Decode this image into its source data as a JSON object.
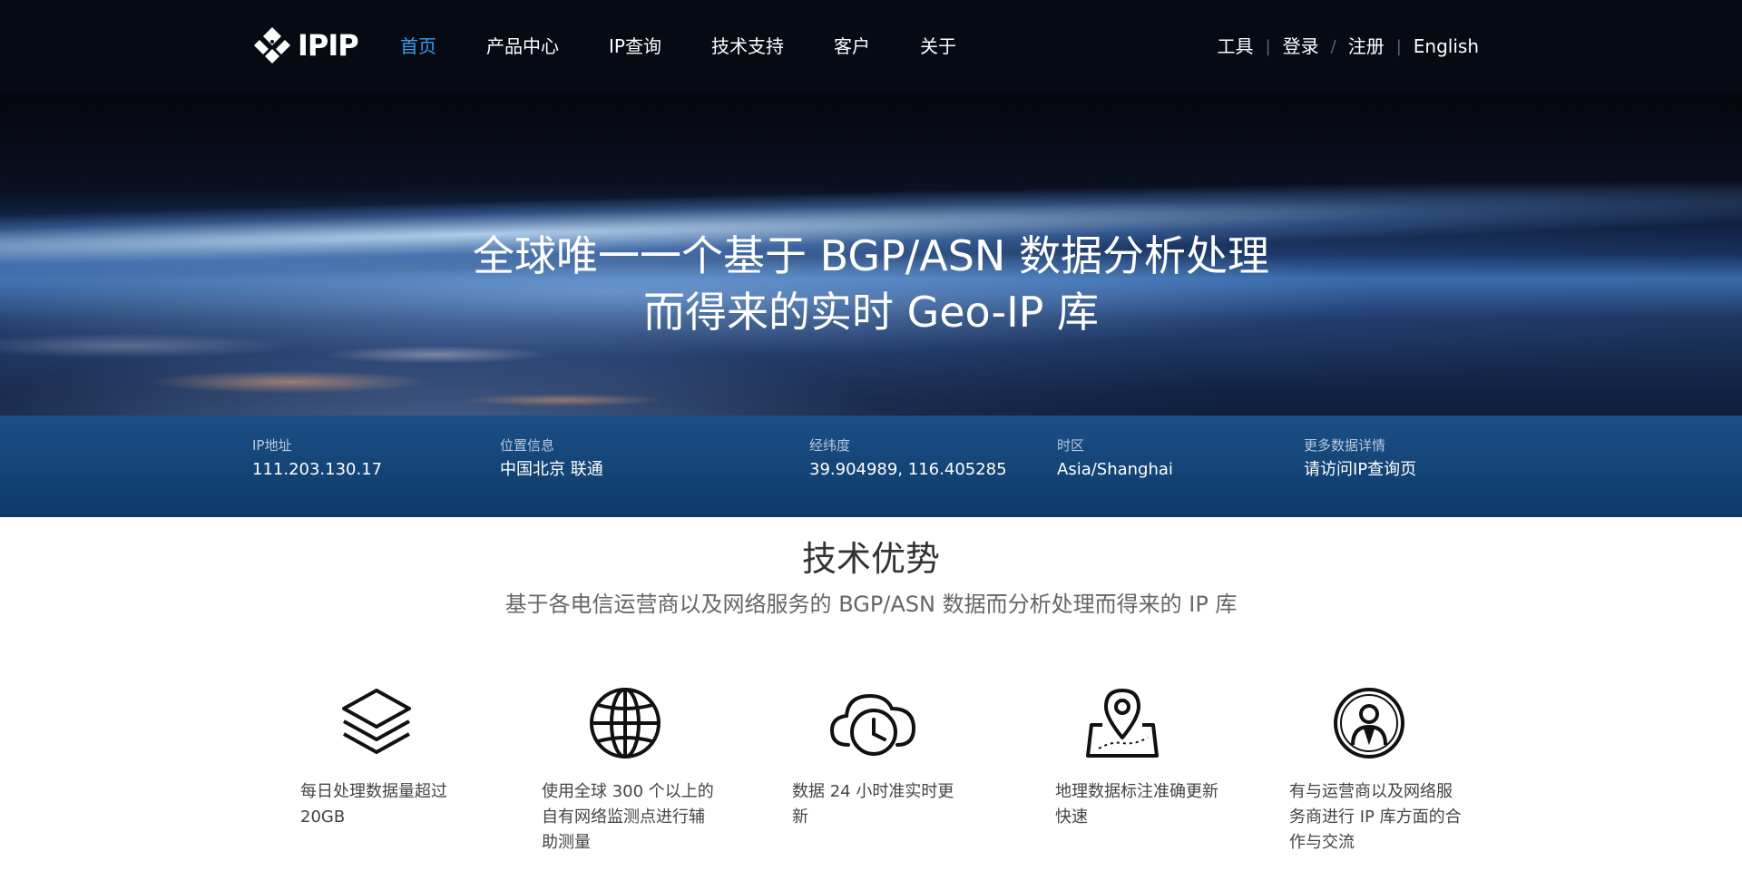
{
  "header": {
    "logo_text": "IPIP",
    "nav": [
      {
        "label": "首页",
        "active": true
      },
      {
        "label": "产品中心",
        "active": false
      },
      {
        "label": "IP查询",
        "active": false
      },
      {
        "label": "技术支持",
        "active": false
      },
      {
        "label": "客户",
        "active": false
      },
      {
        "label": "关于",
        "active": false
      }
    ],
    "right": {
      "tools": "工具",
      "login": "登录",
      "register": "注册",
      "english": "English",
      "sep1": "|",
      "sep2": "/",
      "sep3": "|"
    }
  },
  "hero": {
    "line1": "全球唯一一个基于 BGP/ASN 数据分析处理",
    "line2": "而得来的实时 Geo-IP 库"
  },
  "info": {
    "ip": {
      "label": "IP地址",
      "value": "111.203.130.17"
    },
    "location": {
      "label": "位置信息",
      "value": "中国北京 联通"
    },
    "coords": {
      "label": "经纬度",
      "value": "39.904989, 116.405285"
    },
    "timezone": {
      "label": "时区",
      "value": "Asia/Shanghai"
    },
    "more": {
      "label": "更多数据详情",
      "value": "请访问IP查询页"
    }
  },
  "section": {
    "title": "技术优势",
    "subtitle": "基于各电信运营商以及网络服务的 BGP/ASN 数据而分析处理而得来的 IP 库"
  },
  "features": [
    {
      "icon": "layers-icon",
      "text": "每日处理数据量超过 20GB"
    },
    {
      "icon": "globe-icon",
      "text": "使用全球 300 个以上的自有网络监测点进行辅助测量"
    },
    {
      "icon": "cloud-clock-icon",
      "text": "数据 24 小时准实时更新"
    },
    {
      "icon": "map-pin-icon",
      "text": "地理数据标注准确更新快速"
    },
    {
      "icon": "user-badge-icon",
      "text": "有与运营商以及网络服务商进行 IP 库方面的合作与交流"
    }
  ],
  "colors": {
    "header_bg": "#060a13",
    "nav_active": "#3a9ff0",
    "info_bar": "#134476"
  }
}
